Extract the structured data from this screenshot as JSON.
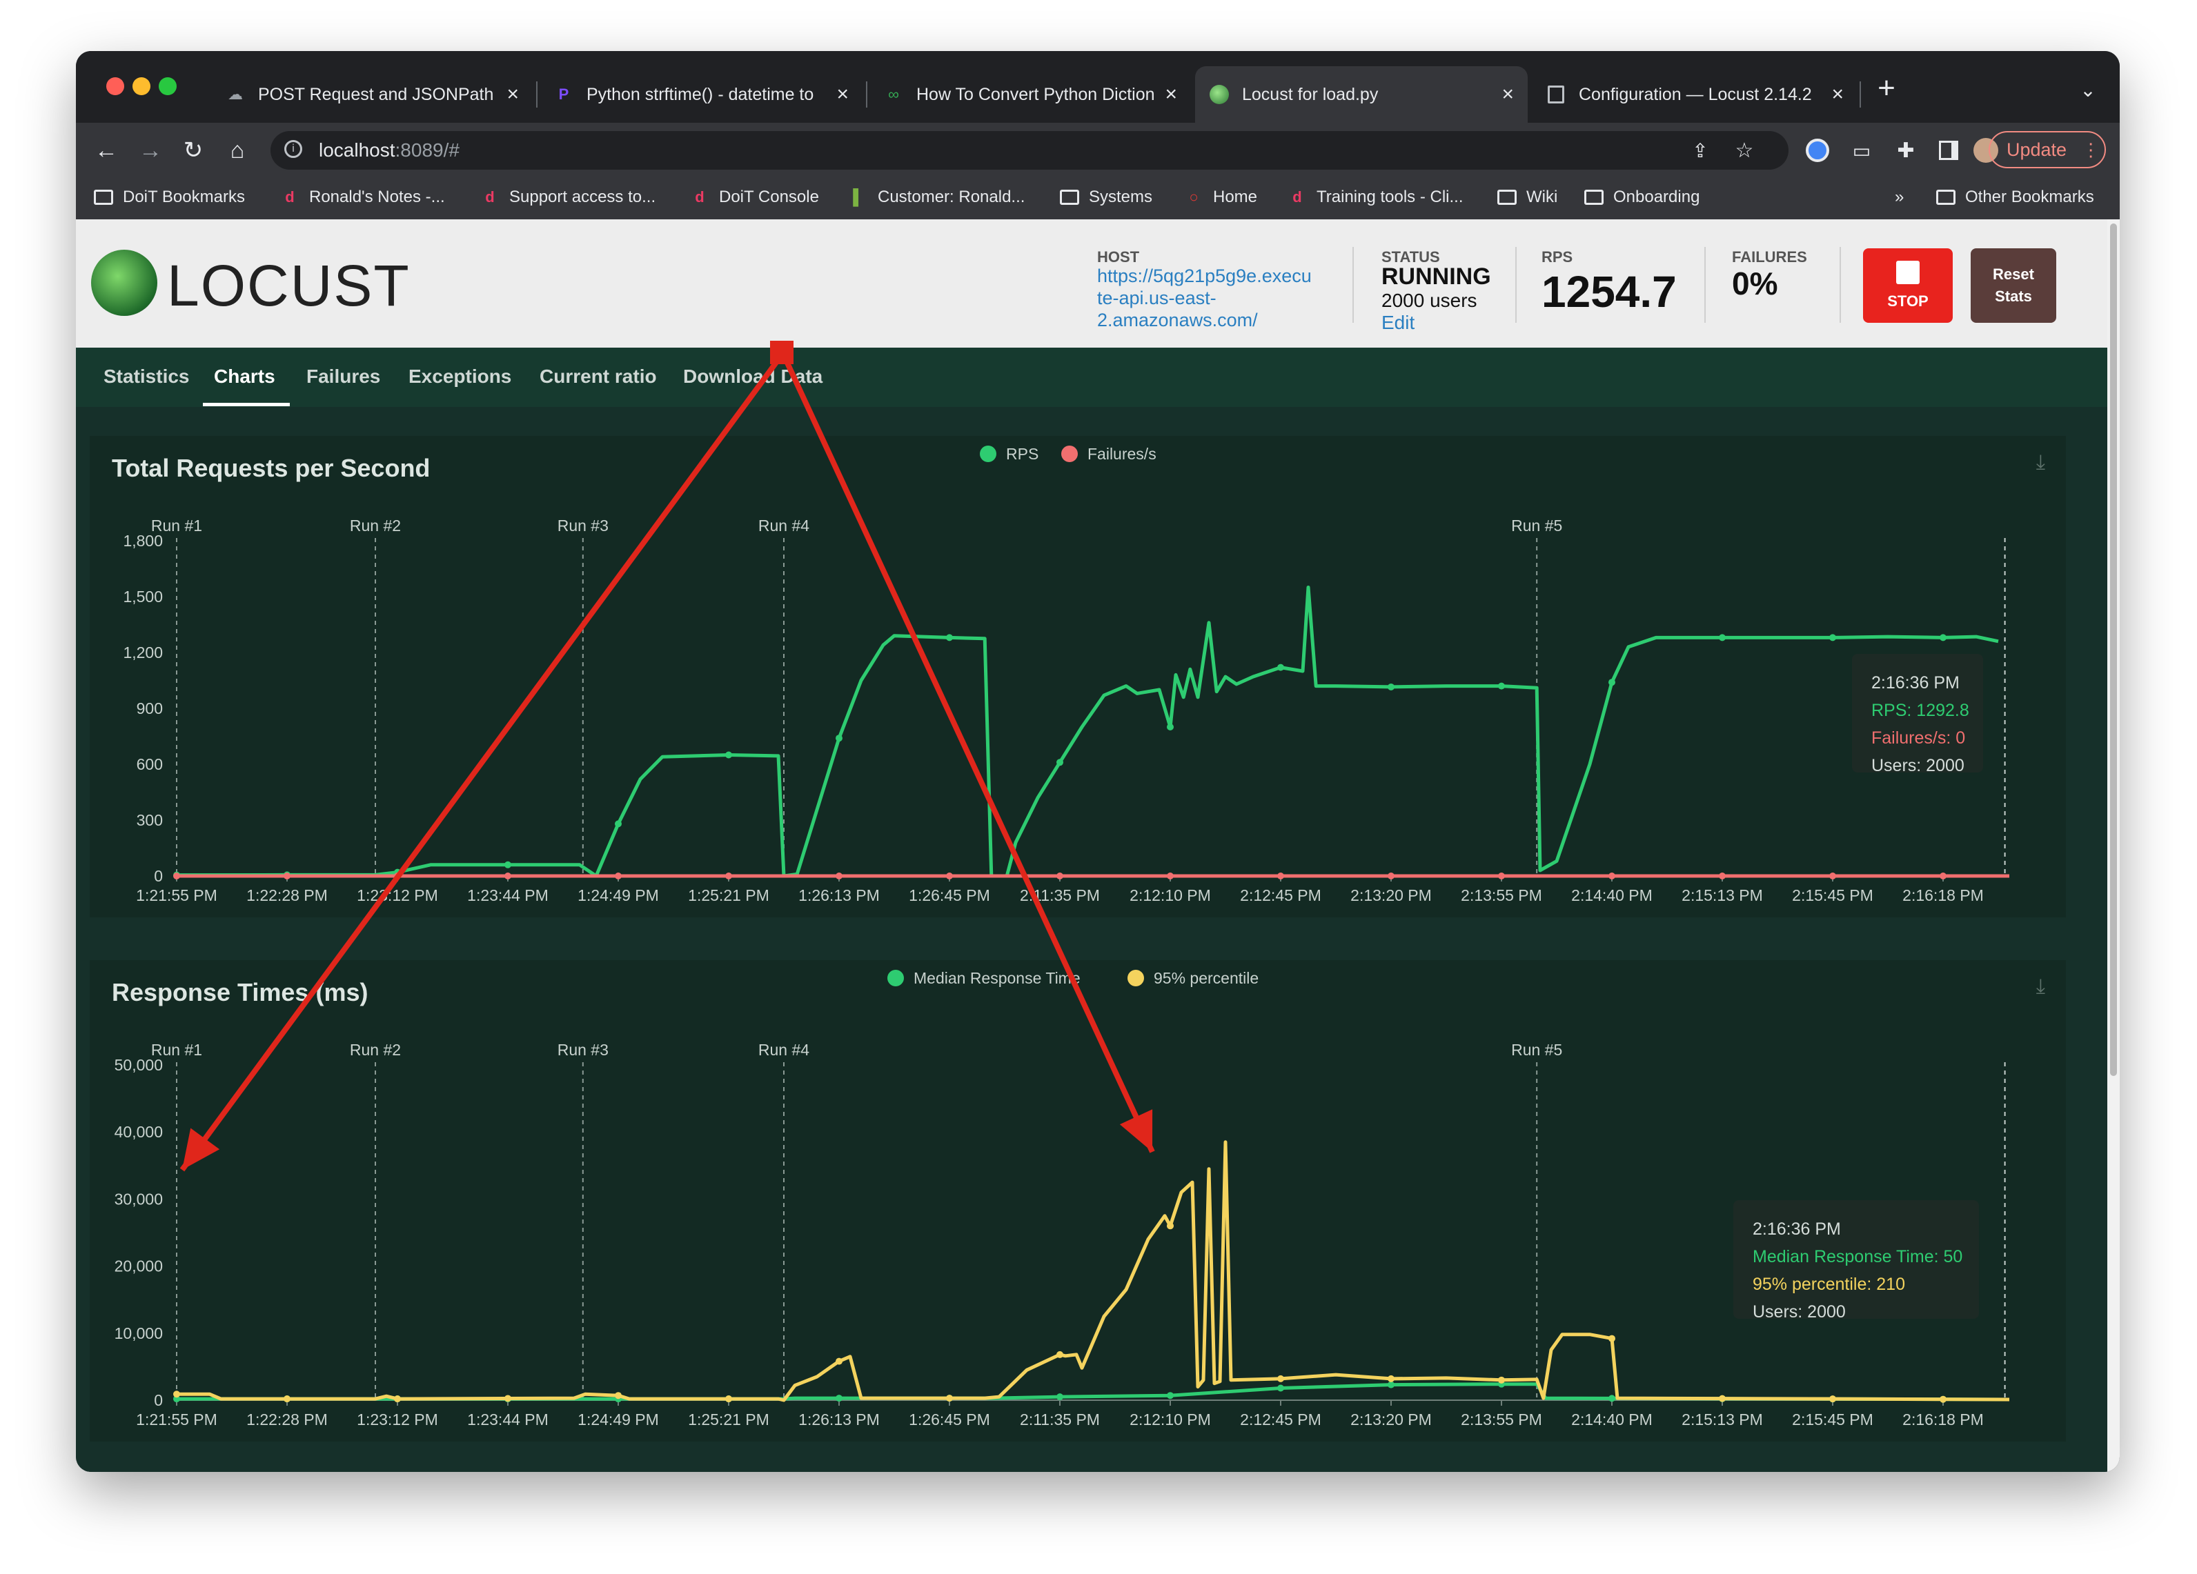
{
  "browser": {
    "tabs": [
      {
        "label": "POST Request and JSONPath U",
        "icon": "cloud-icon",
        "active": false
      },
      {
        "label": "Python strftime() - datetime to",
        "icon": "p-logo-icon",
        "active": false
      },
      {
        "label": "How To Convert Python Diction",
        "icon": "link-icon",
        "active": false
      },
      {
        "label": "Locust for load.py",
        "icon": "locust-icon",
        "active": true
      },
      {
        "label": "Configuration — Locust 2.14.2",
        "icon": "docs-icon",
        "active": false
      }
    ],
    "url_host": "localhost",
    "url_rest": ":8089/#",
    "update_label": "Update",
    "bookmarks": [
      {
        "label": "DoiT Bookmarks",
        "icon": "folder-icon"
      },
      {
        "label": "Ronald's Notes -...",
        "icon": "doit-icon"
      },
      {
        "label": "Support access to...",
        "icon": "doit-icon"
      },
      {
        "label": "DoiT Console",
        "icon": "doit-icon"
      },
      {
        "label": "Customer: Ronald...",
        "icon": "leaf-icon"
      },
      {
        "label": "Systems",
        "icon": "folder-icon"
      },
      {
        "label": "Home",
        "icon": "circle-icon"
      },
      {
        "label": "Training tools - Cli...",
        "icon": "doit-icon"
      },
      {
        "label": "Wiki",
        "icon": "folder-icon"
      },
      {
        "label": "Onboarding",
        "icon": "folder-icon"
      }
    ],
    "overflow_label": "»",
    "other_bookmarks": "Other Bookmarks"
  },
  "header": {
    "logo_text": "LOCUST",
    "host_label": "HOST",
    "host_lines": [
      "https://5qg21p5g9e.execu",
      "te-api.us-east-",
      "2.amazonaws.com/"
    ],
    "status_label": "STATUS",
    "status_value": "RUNNING",
    "users_text": "2000 users",
    "edit_label": "Edit",
    "rps_label": "RPS",
    "rps_value": "1254.7",
    "failures_label": "FAILURES",
    "failures_value": "0%",
    "stop_label": "STOP",
    "reset_label_1": "Reset",
    "reset_label_2": "Stats"
  },
  "nav": {
    "tabs": [
      "Statistics",
      "Charts",
      "Failures",
      "Exceptions",
      "Current ratio",
      "Download Data"
    ],
    "active": "Charts"
  },
  "colors": {
    "rps": "#2ecc71",
    "failures": "#f16f6f",
    "median": "#2ecc71",
    "p95": "#f4d35e",
    "arrow": "#e0261b"
  },
  "chart_data": [
    {
      "type": "line",
      "title": "Total Requests per Second",
      "x": [
        "1:21:55 PM",
        "1:22:28 PM",
        "1:23:12 PM",
        "1:23:44 PM",
        "1:24:49 PM",
        "1:25:21 PM",
        "1:26:13 PM",
        "1:26:45 PM",
        "2:11:35 PM",
        "2:12:10 PM",
        "2:12:45 PM",
        "2:13:20 PM",
        "2:13:55 PM",
        "2:14:40 PM",
        "2:15:13 PM",
        "2:15:45 PM",
        "2:16:18 PM"
      ],
      "ylim": [
        0,
        1800
      ],
      "yticks": [
        "0",
        "300",
        "600",
        "900",
        "1,200",
        "1,500",
        "1,800"
      ],
      "legend": [
        "RPS",
        "Failures/s"
      ],
      "legend_position": "top-center",
      "runs": [
        {
          "label": "Run #1",
          "at": 0
        },
        {
          "label": "Run #2",
          "at": 1.8
        },
        {
          "label": "Run #3",
          "at": 3.68
        },
        {
          "label": "Run #4",
          "at": 5.5
        },
        {
          "label": "Run #5",
          "at": 12.32
        }
      ],
      "series": [
        {
          "name": "RPS",
          "points": [
            [
              0,
              5
            ],
            [
              1,
              6
            ],
            [
              1.8,
              6
            ],
            [
              2,
              20
            ],
            [
              2.3,
              60
            ],
            [
              3,
              60
            ],
            [
              3.65,
              60
            ],
            [
              3.8,
              0
            ],
            [
              4,
              280
            ],
            [
              4.2,
              520
            ],
            [
              4.4,
              640
            ],
            [
              5,
              650
            ],
            [
              5.45,
              645
            ],
            [
              5.5,
              0
            ],
            [
              5.62,
              10
            ],
            [
              6,
              740
            ],
            [
              6.2,
              1050
            ],
            [
              6.4,
              1240
            ],
            [
              6.5,
              1290
            ],
            [
              7,
              1280
            ],
            [
              7.32,
              1275
            ],
            [
              7.38,
              0
            ],
            [
              7.52,
              0
            ],
            [
              7.6,
              180
            ],
            [
              7.8,
              420
            ],
            [
              8,
              610
            ],
            [
              8.2,
              800
            ],
            [
              8.4,
              970
            ],
            [
              8.6,
              1020
            ],
            [
              8.7,
              980
            ],
            [
              8.9,
              1000
            ],
            [
              9,
              800
            ],
            [
              9.05,
              1080
            ],
            [
              9.12,
              960
            ],
            [
              9.18,
              1110
            ],
            [
              9.25,
              960
            ],
            [
              9.35,
              1360
            ],
            [
              9.42,
              990
            ],
            [
              9.5,
              1070
            ],
            [
              9.6,
              1030
            ],
            [
              9.75,
              1070
            ],
            [
              10,
              1120
            ],
            [
              10.2,
              1100
            ],
            [
              10.25,
              1550
            ],
            [
              10.32,
              1020
            ],
            [
              10.5,
              1020
            ],
            [
              11,
              1015
            ],
            [
              11.5,
              1020
            ],
            [
              12,
              1020
            ],
            [
              12.32,
              1010
            ],
            [
              12.35,
              30
            ],
            [
              12.5,
              80
            ],
            [
              12.8,
              600
            ],
            [
              13,
              1040
            ],
            [
              13.15,
              1230
            ],
            [
              13.4,
              1280
            ],
            [
              14,
              1280
            ],
            [
              14.5,
              1280
            ],
            [
              15,
              1280
            ],
            [
              15.5,
              1285
            ],
            [
              16,
              1280
            ],
            [
              16.3,
              1285
            ],
            [
              16.5,
              1260
            ]
          ]
        },
        {
          "name": "Failures/s",
          "points": [
            [
              0,
              0
            ],
            [
              16.6,
              0
            ]
          ]
        }
      ],
      "tooltip": {
        "time": "2:16:36 PM",
        "rps": "RPS: 1292.8",
        "failures": "Failures/s: 0",
        "users": "Users: 2000"
      }
    },
    {
      "type": "line",
      "title": "Response Times (ms)",
      "x": [
        "1:21:55 PM",
        "1:22:28 PM",
        "1:23:12 PM",
        "1:23:44 PM",
        "1:24:49 PM",
        "1:25:21 PM",
        "1:26:13 PM",
        "1:26:45 PM",
        "2:11:35 PM",
        "2:12:10 PM",
        "2:12:45 PM",
        "2:13:20 PM",
        "2:13:55 PM",
        "2:14:40 PM",
        "2:15:13 PM",
        "2:15:45 PM",
        "2:16:18 PM"
      ],
      "ylim": [
        0,
        50000
      ],
      "yticks": [
        "0",
        "10,000",
        "20,000",
        "30,000",
        "40,000",
        "50,000"
      ],
      "legend": [
        "Median Response Time",
        "95% percentile"
      ],
      "legend_position": "top-center",
      "runs": [
        {
          "label": "Run #1",
          "at": 0
        },
        {
          "label": "Run #2",
          "at": 1.8
        },
        {
          "label": "Run #3",
          "at": 3.68
        },
        {
          "label": "Run #4",
          "at": 5.5
        },
        {
          "label": "Run #5",
          "at": 12.32
        }
      ],
      "series": [
        {
          "name": "Median Response Time",
          "points": [
            [
              0,
              200
            ],
            [
              5.5,
              200
            ],
            [
              5.6,
              300
            ],
            [
              7.32,
              300
            ],
            [
              7.4,
              300
            ],
            [
              8,
              500
            ],
            [
              9,
              700
            ],
            [
              10,
              1800
            ],
            [
              11,
              2300
            ],
            [
              12,
              2400
            ],
            [
              12.32,
              2400
            ],
            [
              12.4,
              300
            ],
            [
              16.6,
              100
            ]
          ]
        },
        {
          "name": "95% percentile",
          "points": [
            [
              0,
              900
            ],
            [
              0.3,
              900
            ],
            [
              0.4,
              200
            ],
            [
              1.8,
              200
            ],
            [
              1.9,
              600
            ],
            [
              2,
              200
            ],
            [
              3.6,
              300
            ],
            [
              3.7,
              900
            ],
            [
              4,
              700
            ],
            [
              4.1,
              200
            ],
            [
              5.45,
              200
            ],
            [
              5.5,
              0
            ],
            [
              5.6,
              2200
            ],
            [
              5.8,
              3500
            ],
            [
              6,
              5800
            ],
            [
              6.1,
              6500
            ],
            [
              6.2,
              300
            ],
            [
              7.32,
              300
            ],
            [
              7.45,
              500
            ],
            [
              7.7,
              4500
            ],
            [
              8,
              6800
            ],
            [
              8.05,
              6600
            ],
            [
              8.15,
              6800
            ],
            [
              8.2,
              4800
            ],
            [
              8.4,
              12500
            ],
            [
              8.6,
              16500
            ],
            [
              8.8,
              24000
            ],
            [
              8.95,
              27500
            ],
            [
              9,
              26000
            ],
            [
              9.1,
              31000
            ],
            [
              9.2,
              32500
            ],
            [
              9.25,
              2000
            ],
            [
              9.3,
              3000
            ],
            [
              9.35,
              34500
            ],
            [
              9.4,
              2500
            ],
            [
              9.45,
              2800
            ],
            [
              9.5,
              38500
            ],
            [
              9.55,
              3000
            ],
            [
              10,
              3200
            ],
            [
              10.5,
              3800
            ],
            [
              11,
              3200
            ],
            [
              11.5,
              3300
            ],
            [
              12,
              3000
            ],
            [
              12.32,
              3100
            ],
            [
              12.38,
              300
            ],
            [
              12.45,
              7500
            ],
            [
              12.55,
              9800
            ],
            [
              12.8,
              9800
            ],
            [
              13,
              9200
            ],
            [
              13.05,
              300
            ],
            [
              16.6,
              100
            ]
          ]
        }
      ],
      "tooltip": {
        "time": "2:16:36 PM",
        "median": "Median Response Time: 50",
        "p95": "95% percentile: 210",
        "users": "Users: 2000"
      }
    }
  ]
}
